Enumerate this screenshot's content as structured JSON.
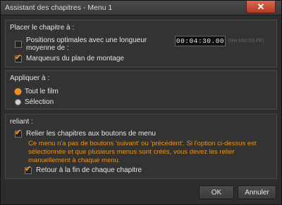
{
  "window": {
    "title": "Assistant des chapitres - Menu 1",
    "close_glyph": "✕"
  },
  "placement": {
    "title": "Placer le chapitre à :",
    "optimal_label_line1": "Positions optimales avec une longueur",
    "optimal_label_line2": "moyenne de :",
    "optimal_checked": false,
    "timecode": "00:04:30.00",
    "timecode_format": "(HH:MM:SS.FF)",
    "markers_label": "Marqueurs du plan de montage",
    "markers_checked": true
  },
  "apply": {
    "title": "Appliquer à :",
    "options": [
      "Tout le film",
      "Sélection"
    ],
    "selected": "Tout le film"
  },
  "link": {
    "title": "reliant :",
    "link_label": "Relier les chapitres aux boutons de menu",
    "link_checked": true,
    "info_line1": "Ce menu n'a pas de boutons 'suivant' ou 'précédent'. Si l'option ci-dessus est",
    "info_line2": "sélectionnée et que plusieurs menus sont créés, vous devez les relier",
    "info_line3": "manuellement à chaque menu.",
    "return_label": "Retour à la fin de chaque chapitre",
    "return_checked": true
  },
  "buttons": {
    "ok": "OK",
    "cancel": "Annuler"
  },
  "colors": {
    "accent": "#f08a1e",
    "info_text": "#e8931f",
    "close_red": "#c8432b"
  },
  "icons": {
    "close": "close-icon",
    "check": "checkmark-icon"
  }
}
